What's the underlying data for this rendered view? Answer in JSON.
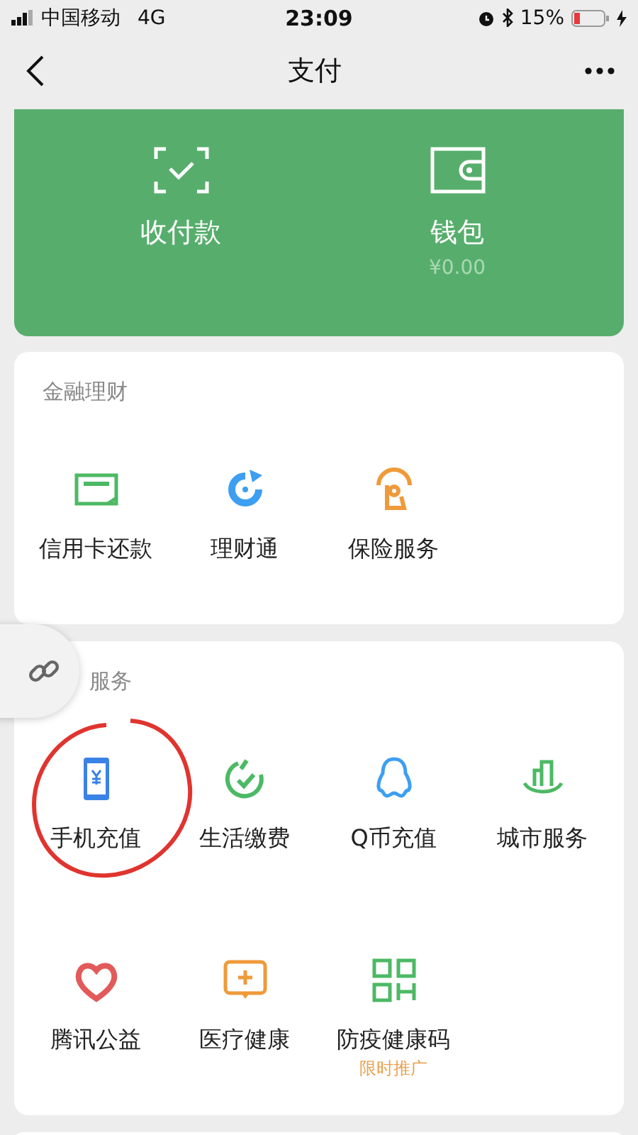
{
  "status_bar": {
    "carrier": "中国移动",
    "network": "4G",
    "time": "23:09",
    "battery": "15%"
  },
  "nav": {
    "title": "支付"
  },
  "pay_card": {
    "items": [
      {
        "label": "收付款"
      },
      {
        "label": "钱包",
        "sub": "¥0.00"
      }
    ]
  },
  "sections": [
    {
      "title": "金融理财",
      "items": [
        {
          "label": "信用卡还款"
        },
        {
          "label": "理财通"
        },
        {
          "label": "保险服务"
        }
      ]
    },
    {
      "title": "服务",
      "items": [
        {
          "label": "手机充值"
        },
        {
          "label": "生活缴费"
        },
        {
          "label": "Q币充值"
        },
        {
          "label": "城市服务"
        },
        {
          "label": "腾讯公益"
        },
        {
          "label": "医疗健康"
        },
        {
          "label": "防疫健康码",
          "badge": "限时推广"
        }
      ]
    }
  ]
}
